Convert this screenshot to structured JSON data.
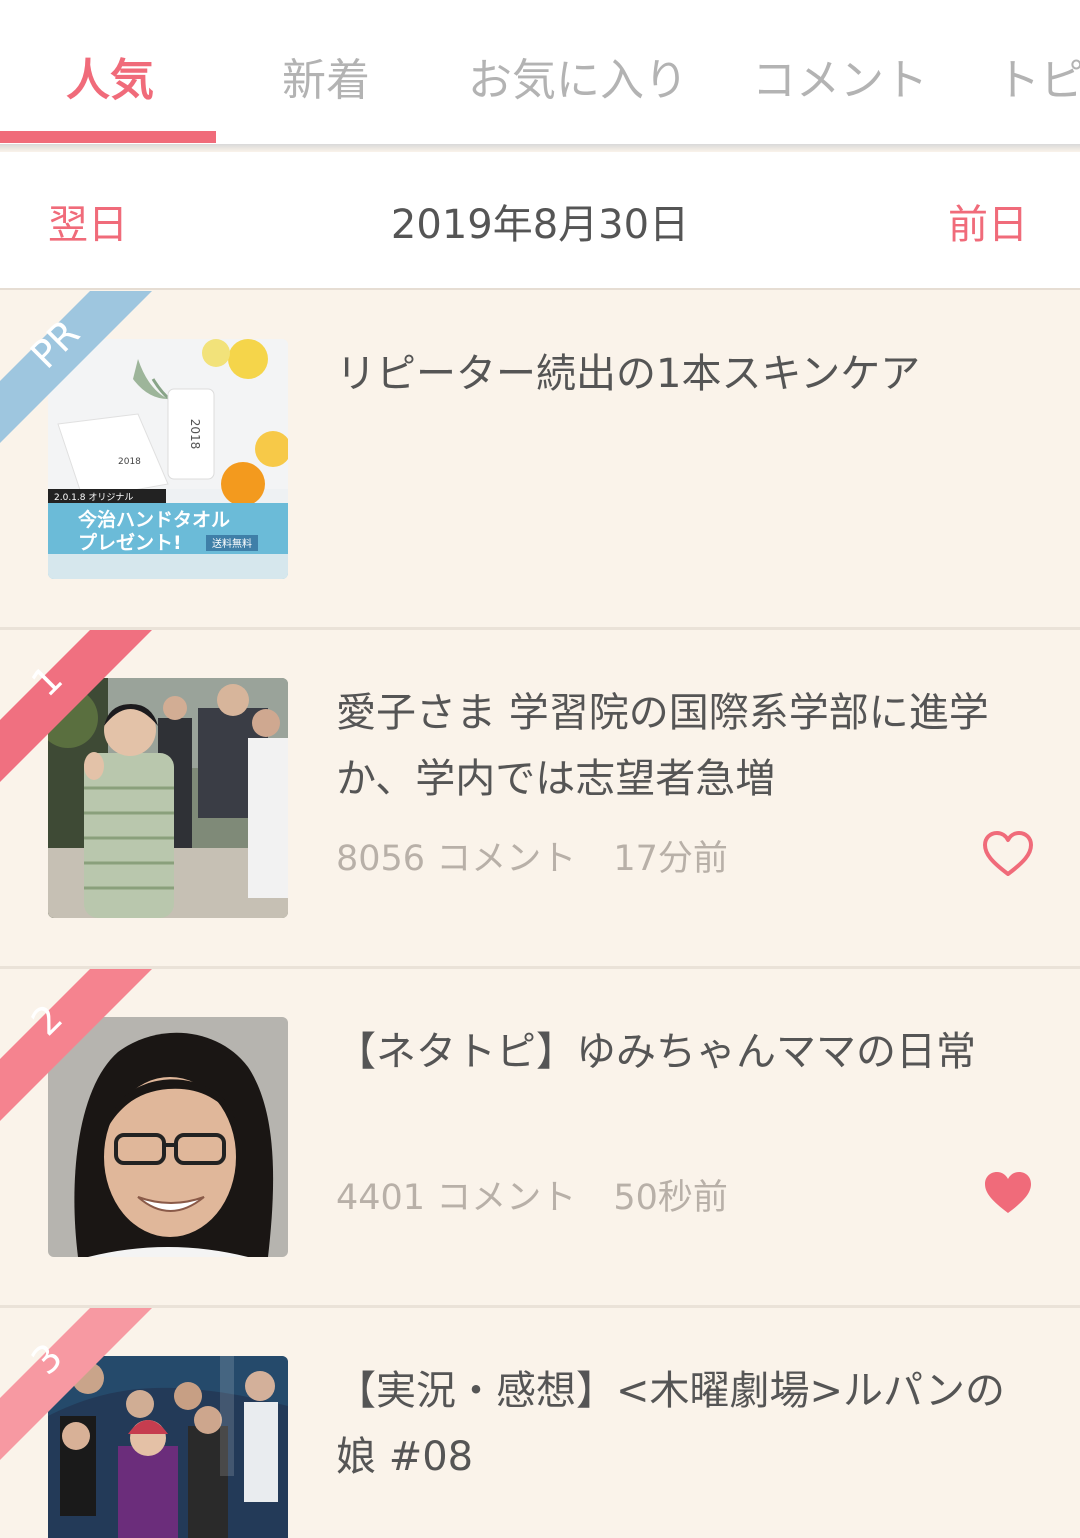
{
  "tabs": [
    {
      "label": "人気",
      "active": true
    },
    {
      "label": "新着",
      "active": false
    },
    {
      "label": "お気に入り",
      "active": false
    },
    {
      "label": "コメント",
      "active": false
    },
    {
      "label": "トピ",
      "active": false
    }
  ],
  "datebar": {
    "next_label": "翌日",
    "date": "2019年8月30日",
    "prev_label": "前日"
  },
  "colors": {
    "accent": "#f06b7a",
    "pr_ribbon": "#9ec6df",
    "background": "#faf3ea"
  },
  "items": [
    {
      "badge": "PR",
      "title": "リピーター続出の1本スキンケア",
      "comments": "",
      "time": "",
      "favorite": null,
      "thumb_icon": "skincare-ad-image",
      "thumb_text": {
        "banner_top": "2.0.1.8 オリジナル",
        "banner_line1": "今治ハンドタオル",
        "banner_line2": "プレゼント!",
        "banner_tag": "送料無料",
        "product": "2018"
      }
    },
    {
      "badge": "1",
      "title": "愛子さま 学習院の国際系学部に進学か、学内では志望者急増",
      "comments": "8056 コメント",
      "time": "17分前",
      "favorite": false,
      "thumb_icon": "news-photo-walking"
    },
    {
      "badge": "2",
      "title": "【ネタトピ】ゆみちゃんママの日常",
      "comments": "4401 コメント",
      "time": "50秒前",
      "favorite": true,
      "thumb_icon": "portrait-photo"
    },
    {
      "badge": "3",
      "title": "【実況・感想】<木曜劇場>ルパンの娘 #08",
      "comments": "",
      "time": "",
      "favorite": null,
      "thumb_icon": "drama-poster"
    }
  ]
}
